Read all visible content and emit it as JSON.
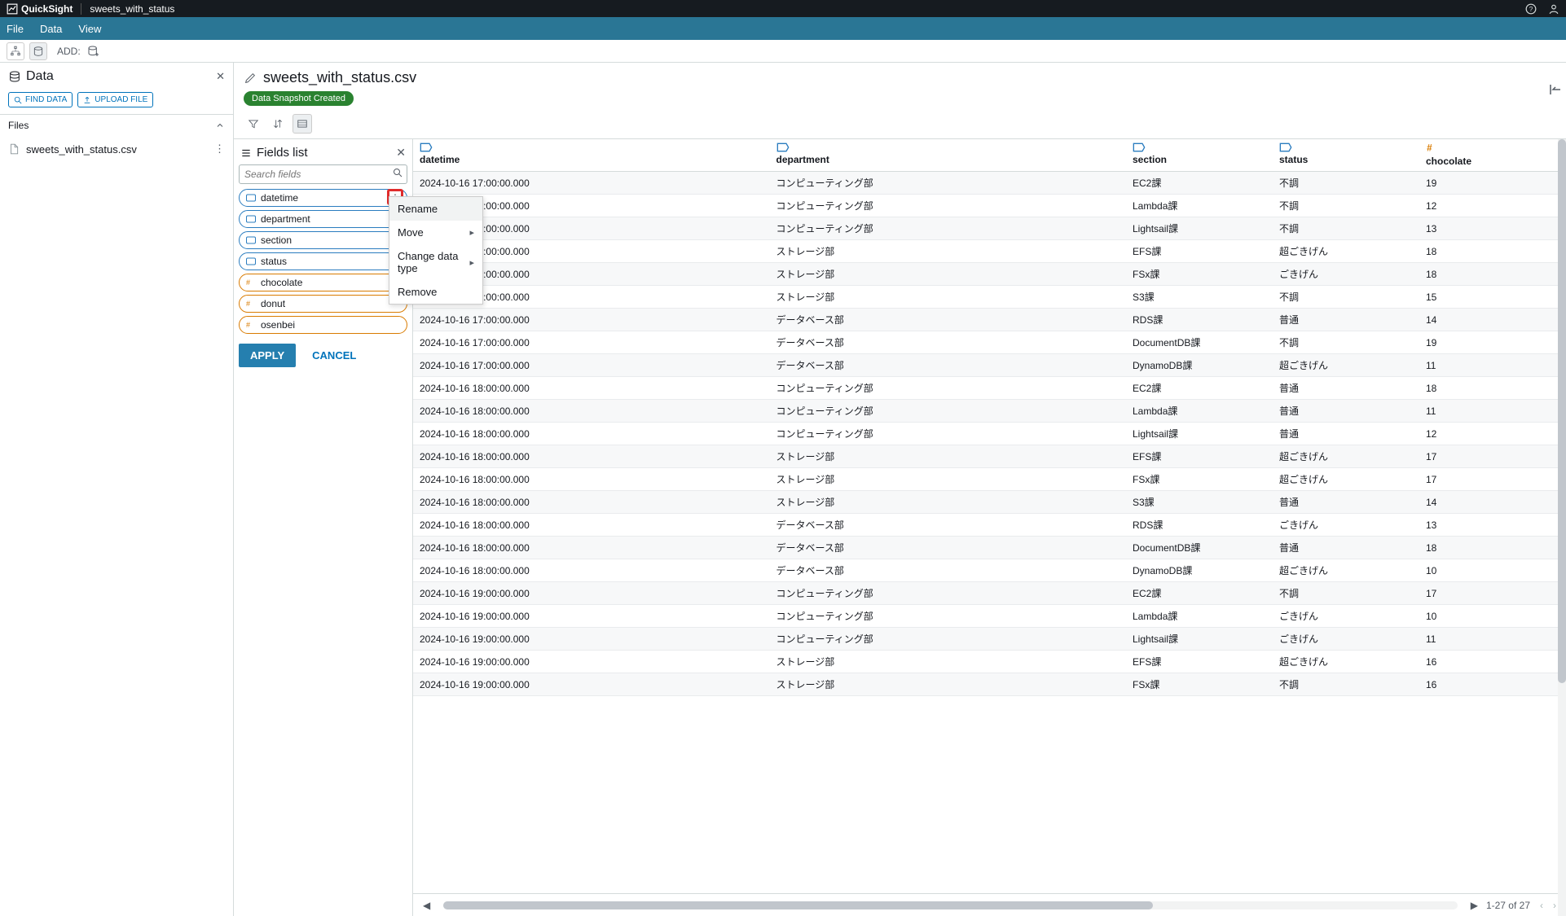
{
  "topbar": {
    "brand": "QuickSight",
    "doc_name": "sweets_with_status"
  },
  "menubar": {
    "file": "File",
    "data": "Data",
    "view": "View"
  },
  "toolbar": {
    "add_label": "ADD:"
  },
  "left": {
    "title": "Data",
    "find_label": "FIND DATA",
    "upload_label": "UPLOAD FILE",
    "files_heading": "Files",
    "file_name": "sweets_with_status.csv"
  },
  "center": {
    "title": "sweets_with_status.csv",
    "badge": "Data Snapshot Created"
  },
  "fields_panel": {
    "title": "Fields list",
    "search_placeholder": "Search fields",
    "apply": "APPLY",
    "cancel": "CANCEL",
    "fields": [
      {
        "name": "datetime",
        "type": "string"
      },
      {
        "name": "department",
        "type": "string"
      },
      {
        "name": "section",
        "type": "string"
      },
      {
        "name": "status",
        "type": "string"
      },
      {
        "name": "chocolate",
        "type": "number"
      },
      {
        "name": "donut",
        "type": "number"
      },
      {
        "name": "osenbei",
        "type": "number"
      }
    ],
    "context_menu": {
      "rename": "Rename",
      "move": "Move",
      "change_type": "Change data type",
      "remove": "Remove"
    }
  },
  "table": {
    "columns": [
      {
        "key": "datetime",
        "label": "datetime",
        "type": "string"
      },
      {
        "key": "department",
        "label": "department",
        "type": "string"
      },
      {
        "key": "section",
        "label": "section",
        "type": "string"
      },
      {
        "key": "status",
        "label": "status",
        "type": "string"
      },
      {
        "key": "chocolate",
        "label": "chocolate",
        "type": "number"
      }
    ],
    "rows": [
      {
        "datetime": "2024-10-16 17:00:00.000",
        "department": "コンピューティング部",
        "section": "EC2課",
        "status": "不調",
        "chocolate": "19"
      },
      {
        "datetime": "2024-10-16 17:00:00.000",
        "department": "コンピューティング部",
        "section": "Lambda課",
        "status": "不調",
        "chocolate": "12"
      },
      {
        "datetime": "2024-10-16 17:00:00.000",
        "department": "コンピューティング部",
        "section": "Lightsail課",
        "status": "不調",
        "chocolate": "13"
      },
      {
        "datetime": "2024-10-16 17:00:00.000",
        "department": "ストレージ部",
        "section": "EFS課",
        "status": "超ごきげん",
        "chocolate": "18"
      },
      {
        "datetime": "2024-10-16 17:00:00.000",
        "department": "ストレージ部",
        "section": "FSx課",
        "status": "ごきげん",
        "chocolate": "18"
      },
      {
        "datetime": "2024-10-16 17:00:00.000",
        "department": "ストレージ部",
        "section": "S3課",
        "status": "不調",
        "chocolate": "15"
      },
      {
        "datetime": "2024-10-16 17:00:00.000",
        "department": "データベース部",
        "section": "RDS課",
        "status": "普通",
        "chocolate": "14"
      },
      {
        "datetime": "2024-10-16 17:00:00.000",
        "department": "データベース部",
        "section": "DocumentDB課",
        "status": "不調",
        "chocolate": "19"
      },
      {
        "datetime": "2024-10-16 17:00:00.000",
        "department": "データベース部",
        "section": "DynamoDB課",
        "status": "超ごきげん",
        "chocolate": "11"
      },
      {
        "datetime": "2024-10-16 18:00:00.000",
        "department": "コンピューティング部",
        "section": "EC2課",
        "status": "普通",
        "chocolate": "18"
      },
      {
        "datetime": "2024-10-16 18:00:00.000",
        "department": "コンピューティング部",
        "section": "Lambda課",
        "status": "普通",
        "chocolate": "11"
      },
      {
        "datetime": "2024-10-16 18:00:00.000",
        "department": "コンピューティング部",
        "section": "Lightsail課",
        "status": "普通",
        "chocolate": "12"
      },
      {
        "datetime": "2024-10-16 18:00:00.000",
        "department": "ストレージ部",
        "section": "EFS課",
        "status": "超ごきげん",
        "chocolate": "17"
      },
      {
        "datetime": "2024-10-16 18:00:00.000",
        "department": "ストレージ部",
        "section": "FSx課",
        "status": "超ごきげん",
        "chocolate": "17"
      },
      {
        "datetime": "2024-10-16 18:00:00.000",
        "department": "ストレージ部",
        "section": "S3課",
        "status": "普通",
        "chocolate": "14"
      },
      {
        "datetime": "2024-10-16 18:00:00.000",
        "department": "データベース部",
        "section": "RDS課",
        "status": "ごきげん",
        "chocolate": "13"
      },
      {
        "datetime": "2024-10-16 18:00:00.000",
        "department": "データベース部",
        "section": "DocumentDB課",
        "status": "普通",
        "chocolate": "18"
      },
      {
        "datetime": "2024-10-16 18:00:00.000",
        "department": "データベース部",
        "section": "DynamoDB課",
        "status": "超ごきげん",
        "chocolate": "10"
      },
      {
        "datetime": "2024-10-16 19:00:00.000",
        "department": "コンピューティング部",
        "section": "EC2課",
        "status": "不調",
        "chocolate": "17"
      },
      {
        "datetime": "2024-10-16 19:00:00.000",
        "department": "コンピューティング部",
        "section": "Lambda課",
        "status": "ごきげん",
        "chocolate": "10"
      },
      {
        "datetime": "2024-10-16 19:00:00.000",
        "department": "コンピューティング部",
        "section": "Lightsail課",
        "status": "ごきげん",
        "chocolate": "11"
      },
      {
        "datetime": "2024-10-16 19:00:00.000",
        "department": "ストレージ部",
        "section": "EFS課",
        "status": "超ごきげん",
        "chocolate": "16"
      },
      {
        "datetime": "2024-10-16 19:00:00.000",
        "department": "ストレージ部",
        "section": "FSx課",
        "status": "不調",
        "chocolate": "16"
      }
    ]
  },
  "pagination": {
    "label": "1-27 of 27"
  }
}
